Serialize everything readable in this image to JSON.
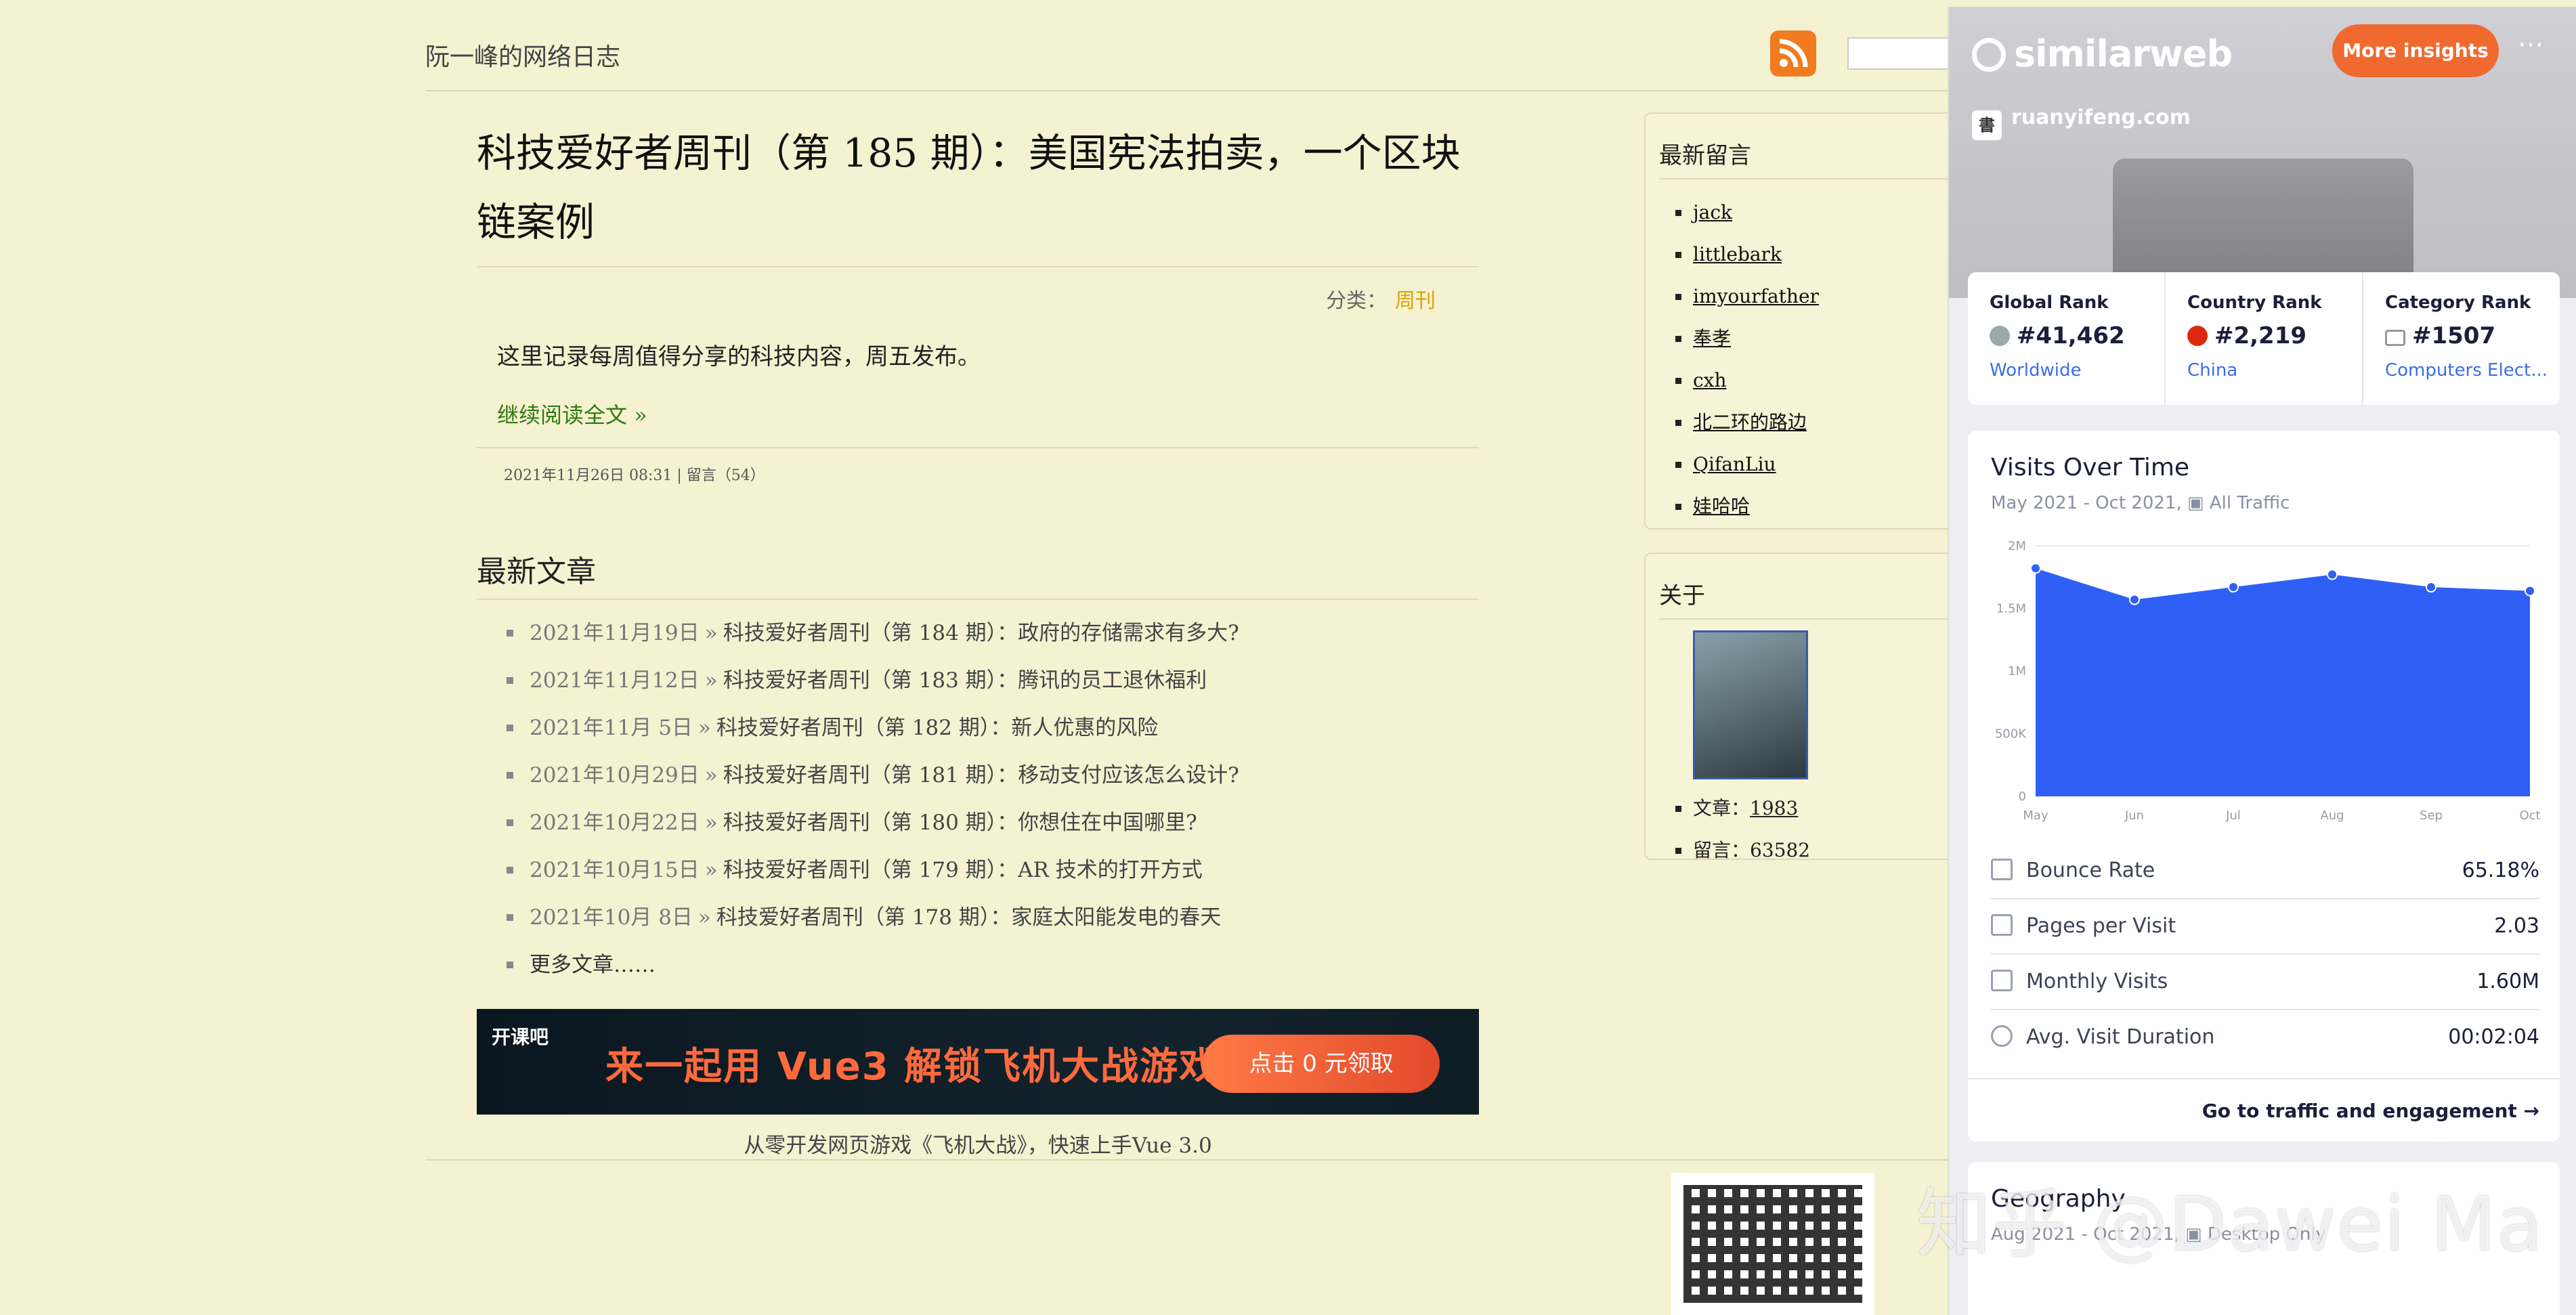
{
  "blog": {
    "site_title": "阮一峰的网络日志"
  },
  "article": {
    "title": "科技爱好者周刊（第 185 期）：美国宪法拍卖，一个区块链案例",
    "category_label": "分类：",
    "category": "周刊",
    "summary": "这里记录每周值得分享的科技内容，周五发布。",
    "read_more": "继续阅读全文 »",
    "meta_date": "2021年11月26日 08:31",
    "meta_sep": "|",
    "meta_comments": "留言（54）"
  },
  "latest": {
    "title": "最新文章",
    "items": [
      {
        "date": "2021年11月19日",
        "link": "科技爱好者周刊（第 184 期）：政府的存储需求有多大?"
      },
      {
        "date": "2021年11月12日",
        "link": "科技爱好者周刊（第 183 期）：腾讯的员工退休福利"
      },
      {
        "date": "2021年11月 5日",
        "link": "科技爱好者周刊（第 182 期）：新人优惠的风险"
      },
      {
        "date": "2021年10月29日",
        "link": "科技爱好者周刊（第 181 期）：移动支付应该怎么设计?"
      },
      {
        "date": "2021年10月22日",
        "link": "科技爱好者周刊（第 180 期）：你想住在中国哪里?"
      },
      {
        "date": "2021年10月15日",
        "link": "科技爱好者周刊（第 179 期）：AR 技术的打开方式"
      },
      {
        "date": "2021年10月 8日",
        "link": "科技爱好者周刊（第 178 期）：家庭太阳能发电的春天"
      }
    ],
    "sep": "»",
    "more": "更多文章……"
  },
  "banner": {
    "logo": "开课吧",
    "text": "来一起用 Vue3 解锁飞机大战游戏",
    "button": "点击 0 元领取",
    "caption": "从零开发网页游戏《飞机大战》，快速上手Vue 3.0"
  },
  "sidebar": {
    "comments_title": "最新留言",
    "commenters": [
      "jack",
      "littlebark",
      "imyourfather",
      "奉孝",
      "cxh",
      "北二环的路边",
      "QifanLiu",
      "娃哈哈"
    ],
    "about_title": "关于",
    "articles_label": "文章：",
    "articles_count": "1983",
    "comments_label": "留言：",
    "comments_count": "63582"
  },
  "similarweb": {
    "logo": "similarweb",
    "more_insights": "More insights",
    "menu": "···",
    "domain": "ruanyifeng.com",
    "favicon": "書",
    "ranks": [
      {
        "label": "Global Rank",
        "value": "#41,462",
        "sub": "Worldwide",
        "icon": "globe-icon"
      },
      {
        "label": "Country Rank",
        "value": "#2,219",
        "sub": "China",
        "icon": "china-flag-icon"
      },
      {
        "label": "Category Rank",
        "value": "#1507",
        "sub": "Computers Elect...",
        "icon": "category-icon"
      }
    ],
    "visits_title": "Visits Over Time",
    "visits_period": "May 2021 - Oct 2021,",
    "visits_traffic": "All Traffic",
    "metrics": [
      {
        "label": "Bounce Rate",
        "value": "65.18%"
      },
      {
        "label": "Pages per Visit",
        "value": "2.03"
      },
      {
        "label": "Monthly Visits",
        "value": "1.60M"
      },
      {
        "label": "Avg. Visit Duration",
        "value": "00:02:04"
      }
    ],
    "traffic_link": "Go to traffic and engagement →",
    "geo_title": "Geography",
    "geo_period": "Aug 2021 - Oct 2021,",
    "geo_traffic": "Desktop Only",
    "accent": "#f06a2f",
    "chart_color": "#2f5ff5"
  },
  "chart_data": {
    "type": "area",
    "categories": [
      "May",
      "Jun",
      "Jul",
      "Aug",
      "Sep",
      "Oct"
    ],
    "values": [
      1820000,
      1570000,
      1670000,
      1770000,
      1670000,
      1640000
    ],
    "yticks": [
      "0",
      "500K",
      "1M",
      "1.5M",
      "2M"
    ],
    "ylim": [
      0,
      2000000
    ]
  },
  "watermark": "知乎 @Dawei Ma"
}
